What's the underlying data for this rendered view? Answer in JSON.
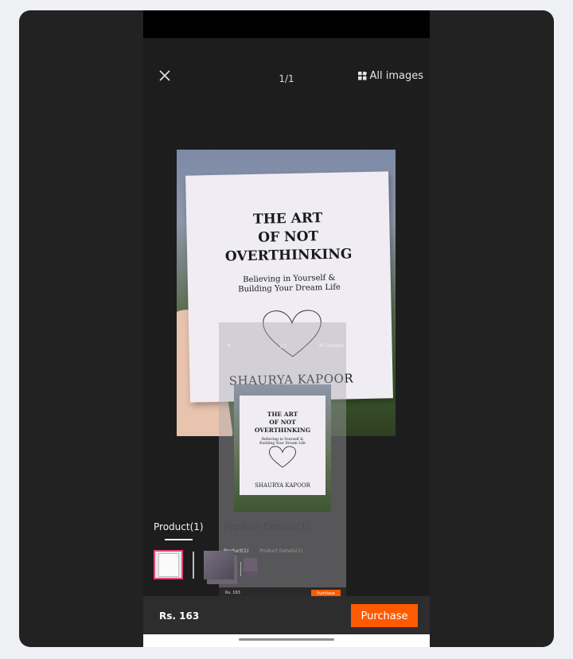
{
  "header": {
    "counter": "1/1",
    "all_images_label": "All images"
  },
  "book": {
    "title_line1": "THE ART",
    "title_line2": "OF NOT",
    "title_line3": "OVERTHINKING",
    "subtitle_line1": "Believing in Yourself &",
    "subtitle_line2": "Building Your Dream Life",
    "author": "SHAURYA KAPOOR"
  },
  "overlay": {
    "counter": "1/1",
    "all_images_label": "All images",
    "tab_product": "Product(1)",
    "tab_details": "Product Details(1)",
    "price": "Rs. 163",
    "purchase_label": "Purchase"
  },
  "tabs": {
    "product": "Product(1)",
    "details": "Product Details(1)"
  },
  "footer": {
    "price": "Rs. 163",
    "purchase_label": "Purchase"
  },
  "colors": {
    "accent": "#ff5a00",
    "thumb_border": "#e0457b",
    "background": "#222222"
  },
  "icons": {
    "close": "close-icon",
    "all_images": "grid-icon"
  }
}
